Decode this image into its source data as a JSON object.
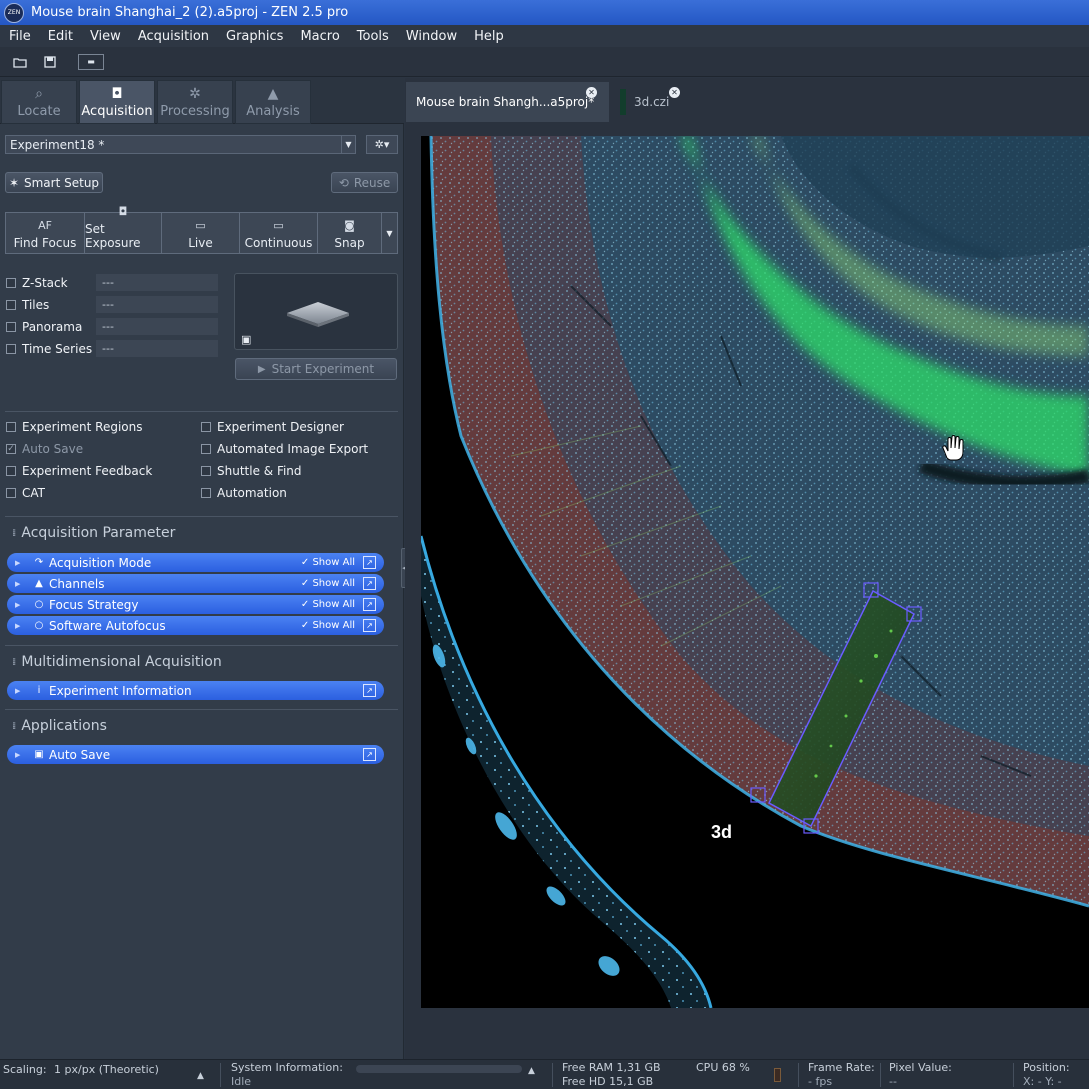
{
  "window": {
    "title": "Mouse brain Shanghai_2 (2).a5proj - ZEN 2.5 pro",
    "logo_text": "ZEN"
  },
  "menu": [
    "File",
    "Edit",
    "View",
    "Acquisition",
    "Graphics",
    "Macro",
    "Tools",
    "Window",
    "Help"
  ],
  "mode_tabs": [
    {
      "label": "Locate",
      "icon": "microscope-icon",
      "active": false
    },
    {
      "label": "Acquisition",
      "icon": "camera-icon",
      "active": true
    },
    {
      "label": "Processing",
      "icon": "processing-icon",
      "active": false
    },
    {
      "label": "Analysis",
      "icon": "analysis-icon",
      "active": false
    }
  ],
  "experiment": {
    "selected": "Experiment18 *"
  },
  "buttons": {
    "smart_setup": "Smart Setup",
    "reuse": "Reuse",
    "start_experiment": "Start Experiment"
  },
  "acq_buttons": [
    {
      "label": "Find Focus",
      "icon_text": "AF"
    },
    {
      "label": "Set Exposure",
      "icon_text": "◘"
    },
    {
      "label": "Live",
      "icon_text": "▭"
    },
    {
      "label": "Continuous",
      "icon_text": "▭"
    },
    {
      "label": "Snap",
      "icon_text": "◙"
    }
  ],
  "dimensions": [
    {
      "label": "Z-Stack",
      "value": "---"
    },
    {
      "label": "Tiles",
      "value": "---"
    },
    {
      "label": "Panorama",
      "value": "---"
    },
    {
      "label": "Time Series",
      "value": "---"
    }
  ],
  "options_left": [
    {
      "label": "Experiment Regions",
      "checked": false,
      "enabled": true
    },
    {
      "label": "Auto Save",
      "checked": true,
      "enabled": false
    },
    {
      "label": "Experiment Feedback",
      "checked": false,
      "enabled": true
    },
    {
      "label": "CAT",
      "checked": false,
      "enabled": true
    }
  ],
  "options_right": [
    {
      "label": "Experiment Designer",
      "checked": false
    },
    {
      "label": "Automated Image Export",
      "checked": false
    },
    {
      "label": "Shuttle & Find",
      "checked": false
    },
    {
      "label": "Automation",
      "checked": false
    }
  ],
  "sections": {
    "acquisition_parameter": "Acquisition Parameter",
    "multidimensional": "Multidimensional Acquisition",
    "applications": "Applications"
  },
  "tool_bars": {
    "acquisition_mode": "Acquisition Mode",
    "channels": "Channels",
    "focus_strategy": "Focus Strategy",
    "software_autofocus": "Software Autofocus",
    "experiment_information": "Experiment Information",
    "auto_save": "Auto Save",
    "show_all": "Show All"
  },
  "doc_tabs": [
    {
      "label": "Mouse brain Shangh...a5proj*",
      "active": true
    },
    {
      "label": "3d.czi",
      "active": false
    }
  ],
  "viewer": {
    "region_label": "3d"
  },
  "status": {
    "scaling_label": "Scaling:",
    "scaling_value": "1 px/px (Theoretic)",
    "sysinfo_label": "System Information:",
    "sysinfo_value": "Idle",
    "free_ram": "Free RAM 1,31 GB",
    "free_hd": "Free HD   15,1 GB",
    "cpu": "CPU 68 %",
    "frame_rate_label": "Frame Rate:",
    "frame_rate_value": "- fps",
    "pixel_value_label": "Pixel Value:",
    "pixel_value_value": "--",
    "position_label": "Position:",
    "position_value": "X: -      Y: -"
  }
}
